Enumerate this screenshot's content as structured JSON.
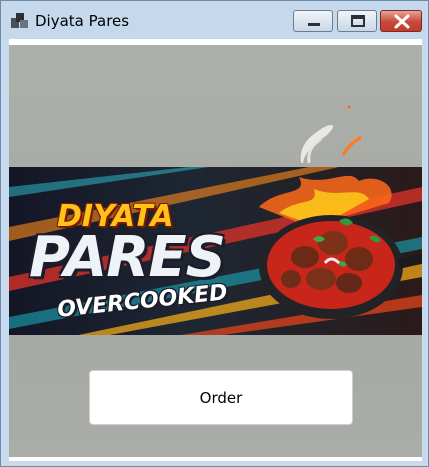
{
  "window": {
    "title": "Diyata Pares"
  },
  "banner": {
    "line1": "DIYATA",
    "line2": "PARES",
    "line3": "OVERCOOKED"
  },
  "order_button": {
    "label": "Order"
  },
  "colors": {
    "titlebar": "#c6d9ec",
    "close_button": "#c53b2c",
    "banner_yellow": "#ffc21a",
    "sauce_red": "#c8261b"
  }
}
